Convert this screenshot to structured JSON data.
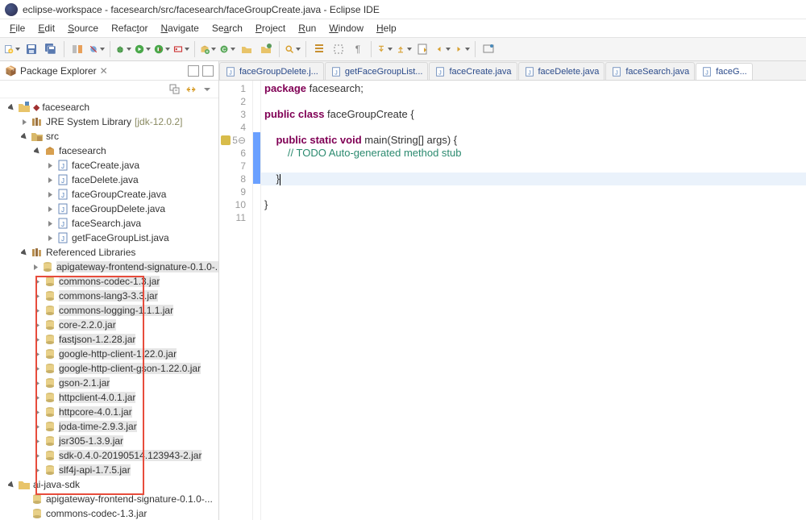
{
  "titlebar": {
    "text": "eclipse-workspace - facesearch/src/facesearch/faceGroupCreate.java - Eclipse IDE"
  },
  "menu": {
    "file": "File",
    "edit": "Edit",
    "source": "Source",
    "refactor": "Refactor",
    "navigate": "Navigate",
    "search": "Search",
    "project": "Project",
    "run": "Run",
    "window": "Window",
    "help": "Help"
  },
  "sidebar": {
    "view_title": "Package Explorer",
    "project": "facesearch",
    "jre": "JRE System Library",
    "jre_deco": "[jdk-12.0.2]",
    "src": "src",
    "pkg": "facesearch",
    "files": [
      "faceCreate.java",
      "faceDelete.java",
      "faceGroupCreate.java",
      "faceGroupDelete.java",
      "faceSearch.java",
      "getFaceGroupList.java"
    ],
    "reflib": "Referenced Libraries",
    "jars": [
      "apigateway-frontend-signature-0.1.0-...",
      "commons-codec-1.3.jar",
      "commons-lang3-3.3.jar",
      "commons-logging-1.1.1.jar",
      "core-2.2.0.jar",
      "fastjson-1.2.28.jar",
      "google-http-client-1.22.0.jar",
      "google-http-client-gson-1.22.0.jar",
      "gson-2.1.jar",
      "httpclient-4.0.1.jar",
      "httpcore-4.0.1.jar",
      "joda-time-2.9.3.jar",
      "jsr305-1.3.9.jar",
      "sdk-0.4.0-20190514.123943-2.jar",
      "slf4j-api-1.7.5.jar"
    ],
    "sdk_folder": "ai-java-sdk",
    "sdk_files": [
      "apigateway-frontend-signature-0.1.0-...",
      "commons-codec-1.3.jar"
    ]
  },
  "tabs": {
    "t0": "faceGroupDelete.j...",
    "t1": "getFaceGroupList...",
    "t2": "faceCreate.java",
    "t3": "faceDelete.java",
    "t4": "faceSearch.java",
    "t5": "faceG..."
  },
  "code": {
    "lines": [
      "1",
      "2",
      "3",
      "4",
      "5",
      "6",
      "7",
      "8",
      "9",
      "10",
      "11"
    ],
    "l1a": "package",
    "l1b": " facesearch;",
    "l3a": "public class",
    "l3b": " faceGroupCreate {",
    "l5a": "    public static void",
    "l5b": " main(String[] args) {",
    "l6": "        // TODO Auto-generated method stub",
    "l8": "    }",
    "l10": "}"
  }
}
